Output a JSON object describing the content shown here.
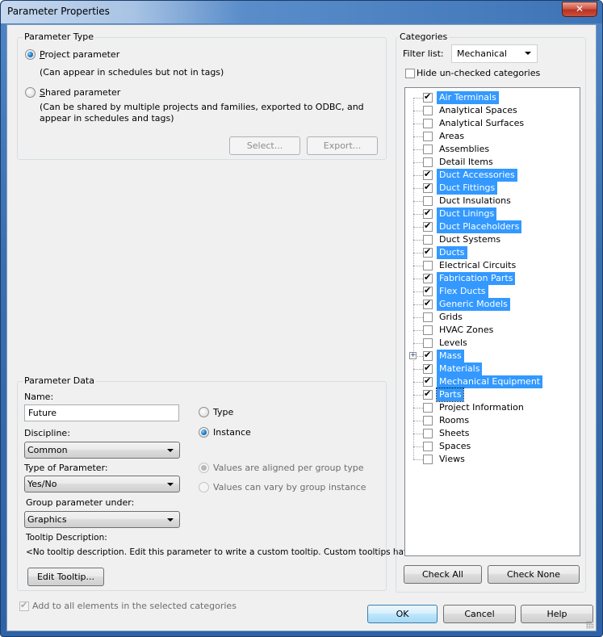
{
  "window": {
    "title": "Parameter Properties",
    "close_glyph": "✕"
  },
  "parameter_type": {
    "title": "Parameter Type",
    "project": {
      "label": "Project parameter",
      "mnemonic": "P",
      "selected": true,
      "description": "(Can appear in schedules but not in tags)"
    },
    "shared": {
      "label": "Shared parameter",
      "mnemonic": "S",
      "selected": false,
      "description_line1": "(Can be shared by multiple projects and families, exported to ODBC, and",
      "description_line2": "appear in schedules and tags)"
    },
    "select_button": "Select...",
    "export_button": "Export..."
  },
  "parameter_data": {
    "title": "Parameter Data",
    "name_label": "Name:",
    "name_value": "Future",
    "discipline_label": "Discipline:",
    "discipline_value": "Common",
    "type_of_parameter_label": "Type of Parameter:",
    "type_of_parameter_value": "Yes/No",
    "group_under_label": "Group parameter under:",
    "group_under_value": "Graphics",
    "tooltip_label": "Tooltip Description:",
    "tooltip_value": "<No tooltip description. Edit this parameter to write a custom tooltip. Custom tooltips hav...",
    "edit_tooltip_button": "Edit Tooltip...",
    "type_radio": {
      "label": "Type",
      "selected": false
    },
    "instance_radio": {
      "label": "Instance",
      "selected": true
    },
    "aligned_radio": {
      "label": "Values are aligned per group type",
      "selected": true,
      "enabled": false
    },
    "vary_radio": {
      "label": "Values can vary by group instance",
      "selected": false,
      "enabled": false
    }
  },
  "add_to_all": {
    "label": "Add to all elements in the selected categories",
    "checked": true,
    "enabled": false
  },
  "categories": {
    "title": "Categories",
    "filter_label": "Filter list:",
    "filter_value": "Mechanical",
    "hide_unchecked_label": "Hide un-checked categories",
    "hide_unchecked_checked": false,
    "items": [
      {
        "label": "Air Terminals",
        "checked": true
      },
      {
        "label": "Analytical Spaces",
        "checked": false
      },
      {
        "label": "Analytical Surfaces",
        "checked": false
      },
      {
        "label": "Areas",
        "checked": false
      },
      {
        "label": "Assemblies",
        "checked": false
      },
      {
        "label": "Detail Items",
        "checked": false
      },
      {
        "label": "Duct Accessories",
        "checked": true
      },
      {
        "label": "Duct Fittings",
        "checked": true
      },
      {
        "label": "Duct Insulations",
        "checked": false
      },
      {
        "label": "Duct Linings",
        "checked": true
      },
      {
        "label": "Duct Placeholders",
        "checked": true
      },
      {
        "label": "Duct Systems",
        "checked": false
      },
      {
        "label": "Ducts",
        "checked": true
      },
      {
        "label": "Electrical Circuits",
        "checked": false
      },
      {
        "label": "Fabrication Parts",
        "checked": true
      },
      {
        "label": "Flex Ducts",
        "checked": true
      },
      {
        "label": "Generic Models",
        "checked": true
      },
      {
        "label": "Grids",
        "checked": false
      },
      {
        "label": "HVAC Zones",
        "checked": false
      },
      {
        "label": "Levels",
        "checked": false
      },
      {
        "label": "Mass",
        "checked": true,
        "expandable": true
      },
      {
        "label": "Materials",
        "checked": true
      },
      {
        "label": "Mechanical Equipment",
        "checked": true
      },
      {
        "label": "Parts",
        "checked": true,
        "focused": true
      },
      {
        "label": "Project Information",
        "checked": false
      },
      {
        "label": "Rooms",
        "checked": false
      },
      {
        "label": "Sheets",
        "checked": false
      },
      {
        "label": "Spaces",
        "checked": false
      },
      {
        "label": "Views",
        "checked": false
      }
    ],
    "check_all_button": "Check All",
    "check_none_button": "Check None"
  },
  "footer": {
    "ok_button": "OK",
    "cancel_button": "Cancel",
    "help_button": "Help"
  },
  "colors": {
    "selection": "#3399ff",
    "title_bar": "#3d73b6",
    "dialog_bg": "#f0f0f0"
  }
}
